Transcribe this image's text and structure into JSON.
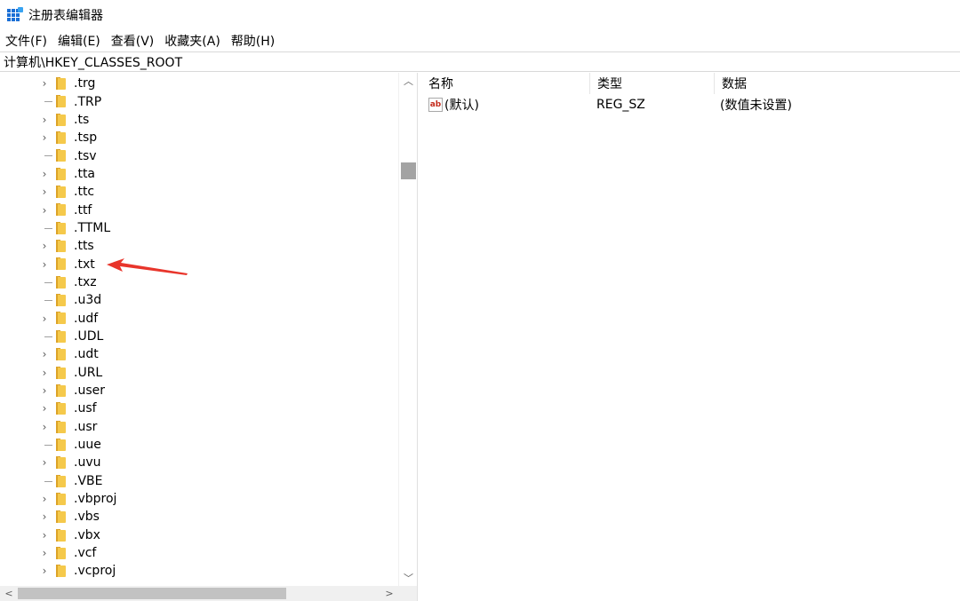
{
  "window": {
    "title": "注册表编辑器",
    "app_icon": "registry-editor-icon"
  },
  "menu": [
    {
      "label": "文件(F)",
      "name": "menu-file"
    },
    {
      "label": "编辑(E)",
      "name": "menu-edit"
    },
    {
      "label": "查看(V)",
      "name": "menu-view"
    },
    {
      "label": "收藏夹(A)",
      "name": "menu-favorites"
    },
    {
      "label": "帮助(H)",
      "name": "menu-help"
    }
  ],
  "address": {
    "path": "计算机\\HKEY_CLASSES_ROOT"
  },
  "tree": {
    "nodes": [
      {
        "label": ".trg",
        "expandable": true
      },
      {
        "label": ".TRP",
        "expandable": false
      },
      {
        "label": ".ts",
        "expandable": true
      },
      {
        "label": ".tsp",
        "expandable": true
      },
      {
        "label": ".tsv",
        "expandable": false
      },
      {
        "label": ".tta",
        "expandable": true
      },
      {
        "label": ".ttc",
        "expandable": true
      },
      {
        "label": ".ttf",
        "expandable": true
      },
      {
        "label": ".TTML",
        "expandable": false
      },
      {
        "label": ".tts",
        "expandable": true
      },
      {
        "label": ".txt",
        "expandable": true
      },
      {
        "label": ".txz",
        "expandable": false
      },
      {
        "label": ".u3d",
        "expandable": false
      },
      {
        "label": ".udf",
        "expandable": true
      },
      {
        "label": ".UDL",
        "expandable": false
      },
      {
        "label": ".udt",
        "expandable": true
      },
      {
        "label": ".URL",
        "expandable": true
      },
      {
        "label": ".user",
        "expandable": true
      },
      {
        "label": ".usf",
        "expandable": true
      },
      {
        "label": ".usr",
        "expandable": true
      },
      {
        "label": ".uue",
        "expandable": false
      },
      {
        "label": ".uvu",
        "expandable": true
      },
      {
        "label": ".VBE",
        "expandable": false
      },
      {
        "label": ".vbproj",
        "expandable": true
      },
      {
        "label": ".vbs",
        "expandable": true
      },
      {
        "label": ".vbx",
        "expandable": true
      },
      {
        "label": ".vcf",
        "expandable": true
      },
      {
        "label": ".vcproj",
        "expandable": true
      }
    ]
  },
  "list": {
    "columns": [
      "名称",
      "类型",
      "数据"
    ],
    "rows": [
      {
        "name": "(默认)",
        "type": "REG_SZ",
        "data": "(数值未设置)",
        "icon": "ab-string-icon"
      }
    ]
  },
  "annotation": {
    "color": "#e8352b",
    "points_to": ".txt"
  }
}
